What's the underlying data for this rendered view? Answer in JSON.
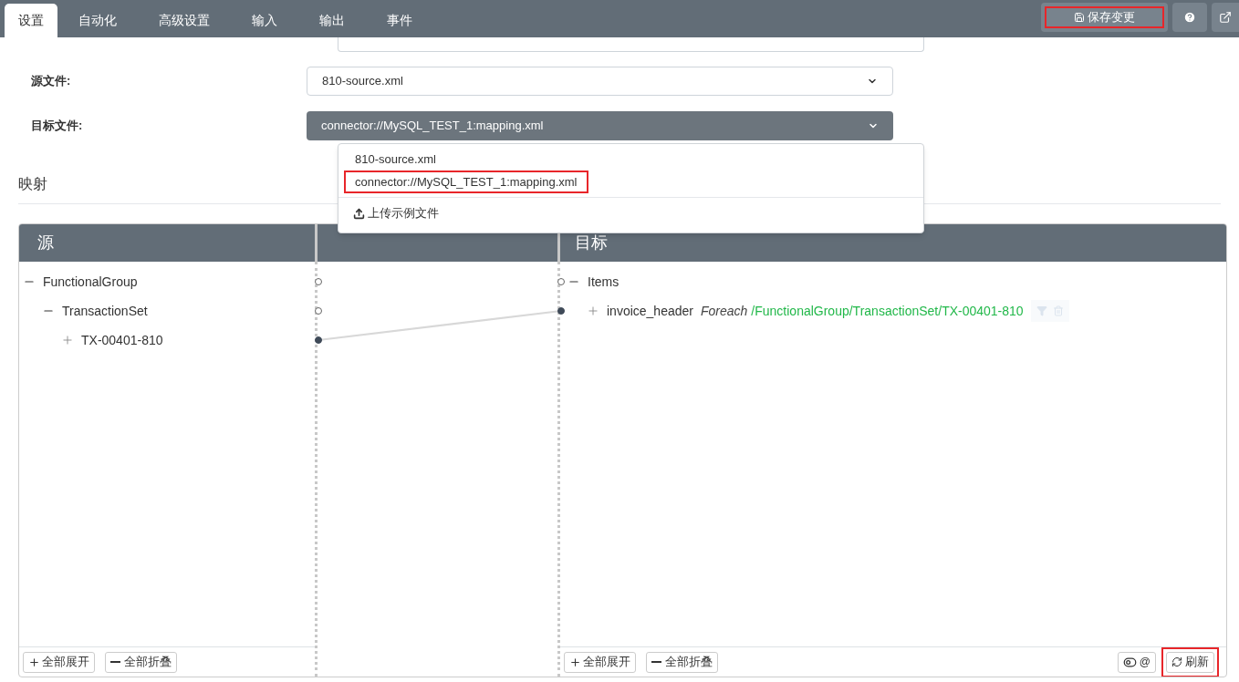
{
  "tabs": [
    {
      "label": "设置",
      "selected": true
    },
    {
      "label": "自动化",
      "selected": false
    },
    {
      "label": "高级设置",
      "selected": false
    },
    {
      "label": "输入",
      "selected": false
    },
    {
      "label": "输出",
      "selected": false
    },
    {
      "label": "事件",
      "selected": false
    }
  ],
  "toolbar": {
    "save": {
      "label": "保存变更",
      "highlighted": true
    }
  },
  "form": {
    "fields": [
      {
        "label": "源文件:",
        "value": "810-source.xml",
        "active": false
      },
      {
        "label": "目标文件:",
        "value": "connector://MySQL_TEST_1:mapping.xml",
        "active": true
      }
    ],
    "dropdown": {
      "options": [
        {
          "label": "810-source.xml",
          "highlighted": false
        },
        {
          "label": "connector://MySQL_TEST_1:mapping.xml",
          "highlighted": true
        }
      ],
      "upload": "上传示例文件"
    }
  },
  "mapping": {
    "title": "映射",
    "source": {
      "title": "源",
      "tree": [
        {
          "label": "FunctionalGroup",
          "expanded": true,
          "connected": false,
          "children": [
            {
              "label": "TransactionSet",
              "expanded": true,
              "connected": false,
              "children": [
                {
                  "label": "TX-00401-810",
                  "expanded": false,
                  "connected": true
                }
              ]
            }
          ]
        }
      ],
      "expand_all": "全部展开",
      "collapse_all": "全部折叠"
    },
    "target": {
      "title": "目标",
      "tree": [
        {
          "label": "Items",
          "expanded": true,
          "connected": false,
          "children": [
            {
              "label": "invoice_header",
              "expanded": false,
              "connected": true,
              "mode": "Foreach",
              "path": "/FunctionalGroup/TransactionSet/TX-00401-810"
            }
          ]
        }
      ],
      "expand_all": "全部展开",
      "collapse_all": "全部折叠",
      "toggle_label": "@",
      "refresh": {
        "label": "刷新",
        "highlighted": true
      }
    }
  }
}
